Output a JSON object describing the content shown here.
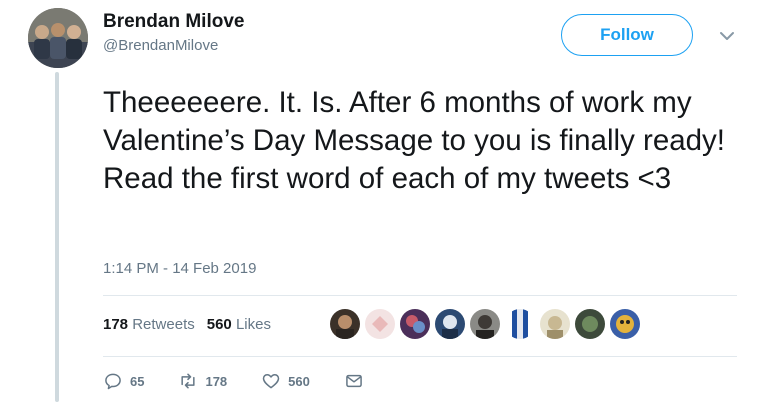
{
  "author": {
    "name": "Brendan Milove",
    "handle": "@BrendanMilove"
  },
  "follow_label": "Follow",
  "tweet": {
    "text": "Theeeeeere. It. Is. After 6 months of work my Valentine’s Day Message to you is finally ready! Read the first word of each of my tweets <3",
    "timestamp": "1:14 PM - 14 Feb 2019"
  },
  "stats": {
    "retweets_count": "178",
    "retweets_label": "Retweets",
    "likes_count": "560",
    "likes_label": "Likes"
  },
  "actions": {
    "replies": "65",
    "retweets": "178",
    "likes": "560"
  },
  "colors": {
    "accent": "#1da1f2",
    "muted": "#657786"
  }
}
